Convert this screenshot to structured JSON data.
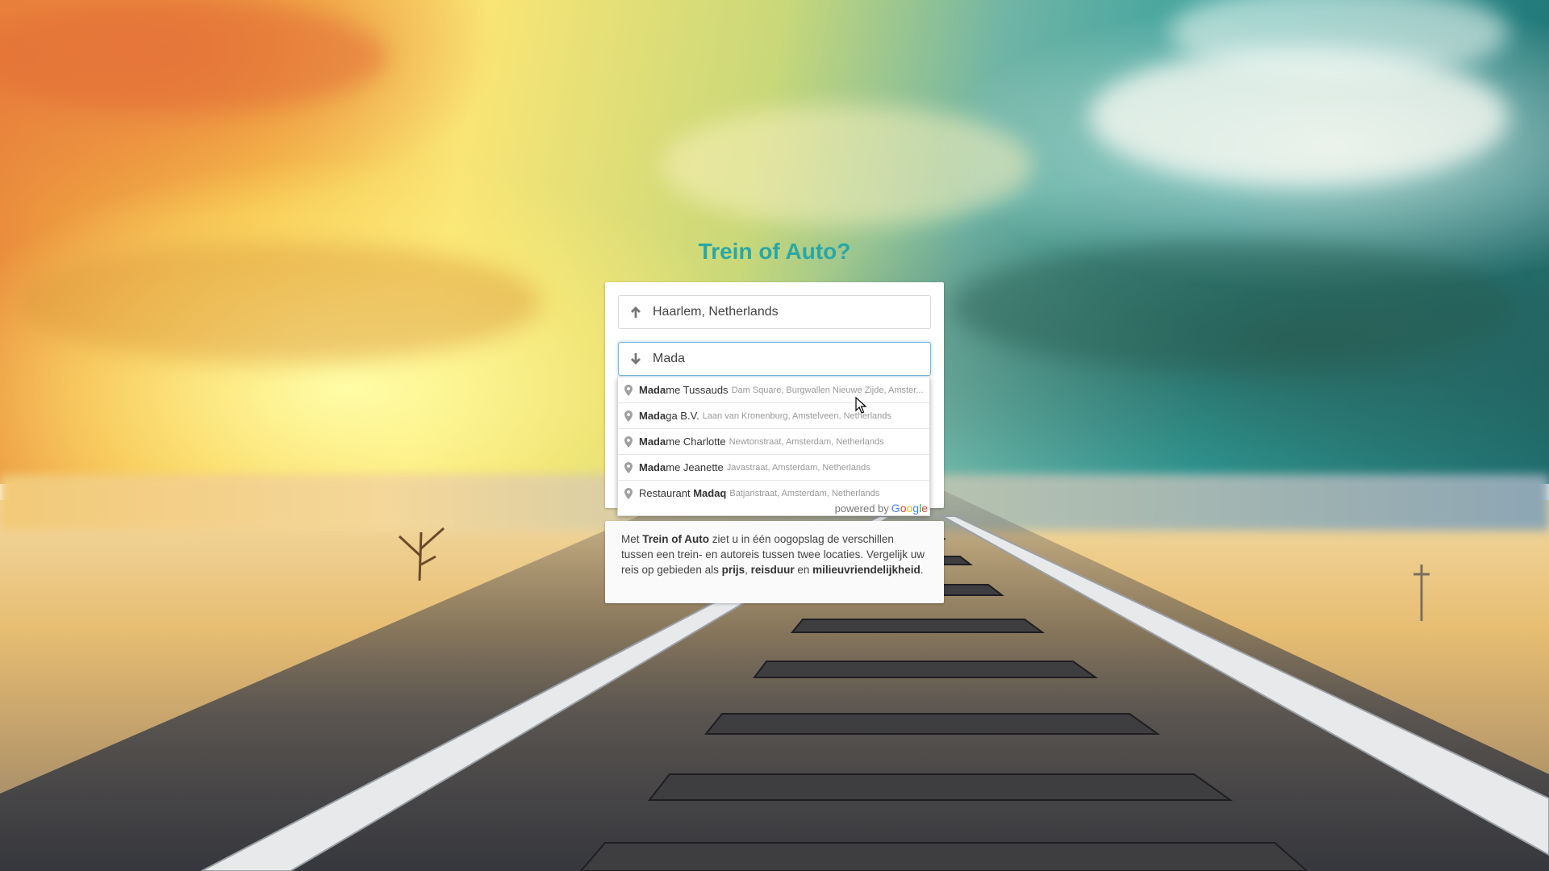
{
  "app": {
    "title": "Trein of Auto?"
  },
  "form": {
    "origin_value": "Haarlem, Netherlands",
    "origin_icon": "arrow-up-icon",
    "destination_value": "Mada",
    "destination_icon": "arrow-down-icon"
  },
  "autocomplete": {
    "items": [
      {
        "match": "Mada",
        "rest": "me Tussauds",
        "secondary": "Dam Square, Burgwallen Nieuwe Zijde, Amster..."
      },
      {
        "match": "Mada",
        "rest": "ga B.V.",
        "secondary": "Laan van Kronenburg, Amstelveen, Netherlands"
      },
      {
        "match": "Mada",
        "rest": "me Charlotte",
        "secondary": "Newtonstraat, Amsterdam, Netherlands"
      },
      {
        "match": "Mada",
        "rest": "me Jeanette",
        "secondary": "Javastraat, Amsterdam, Netherlands"
      },
      {
        "prefix": "Restaurant ",
        "match": "Madaq",
        "rest": "",
        "secondary": "Batjanstraat, Amsterdam, Netherlands"
      }
    ],
    "powered_by": "powered by",
    "brand": [
      "G",
      "o",
      "o",
      "g",
      "l",
      "e"
    ]
  },
  "info": {
    "part1": "Met ",
    "brand": "Trein of Auto",
    "part2": " ziet u in één oogopslag de verschillen tussen een trein- en autoreis tussen twee locaties. Vergelijk uw reis op gebieden als ",
    "kw1": "prijs",
    "sep1": ", ",
    "kw2": "reisduur",
    "sep2": " en ",
    "kw3": "milieuvriendelijkheid",
    "end": "."
  },
  "colors": {
    "accent": "#2aa7a5",
    "focus_border": "#7ab8d6"
  }
}
